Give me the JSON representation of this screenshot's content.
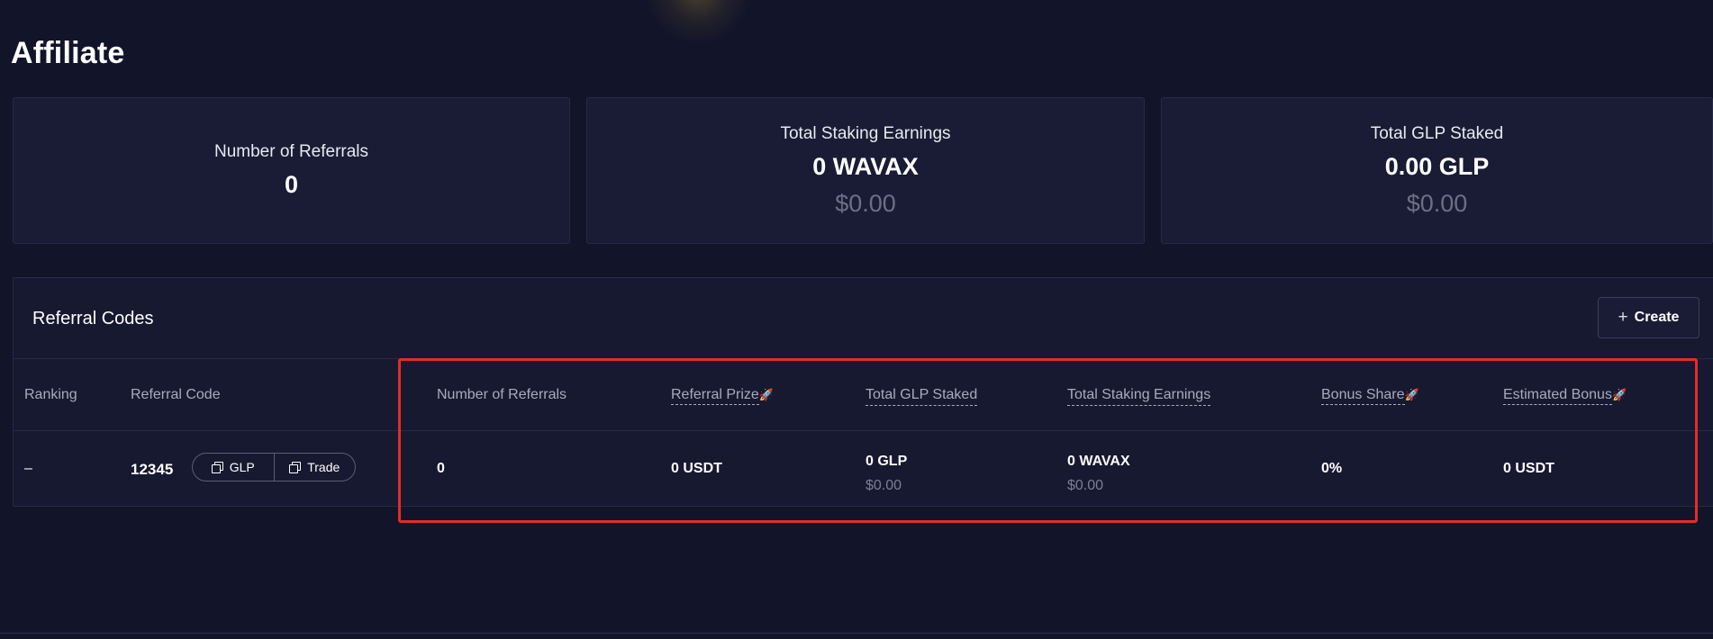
{
  "page": {
    "title": "Affiliate"
  },
  "stats": [
    {
      "label": "Number of Referrals",
      "value": "0"
    },
    {
      "label": "Total Staking Earnings",
      "value": "0 WAVAX",
      "usd": "$0.00"
    },
    {
      "label": "Total GLP Staked",
      "value": "0.00 GLP",
      "usd": "$0.00"
    }
  ],
  "referral_codes": {
    "title": "Referral Codes",
    "create_label": "Create",
    "columns": {
      "ranking": "Ranking",
      "code": "Referral Code",
      "referrals": "Number of Referrals",
      "prize": "Referral Prize",
      "glp_staked": "Total GLP Staked",
      "earnings": "Total Staking Earnings",
      "bonus_share": "Bonus Share",
      "est_bonus": "Estimated Bonus"
    },
    "rows": [
      {
        "ranking": "–",
        "code": "12345",
        "copy_glp_label": "GLP",
        "copy_trade_label": "Trade",
        "referrals": "0",
        "prize": "0 USDT",
        "glp_staked": "0 GLP",
        "glp_staked_usd": "$0.00",
        "earnings": "0 WAVAX",
        "earnings_usd": "$0.00",
        "bonus_share": "0%",
        "est_bonus": "0 USDT"
      }
    ]
  },
  "colors": {
    "background": "#12142a",
    "card": "#191c34",
    "highlight_border": "#e32c2c",
    "muted_text": "#6c6f86"
  },
  "icons": [
    "plus-icon",
    "rocket-icon",
    "copy-icon"
  ]
}
